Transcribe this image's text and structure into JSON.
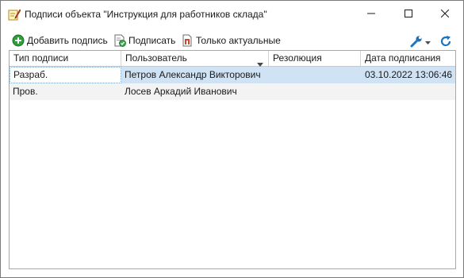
{
  "window": {
    "title": "Подписи объекта \"Инструкция для работников склада\"",
    "icon": "signature-pen-icon",
    "controls": {
      "minimize": "minimize-icon",
      "maximize": "maximize-icon",
      "close": "close-icon"
    }
  },
  "toolbar": {
    "add_label": "Добавить подпись",
    "sign_label": "Подписать",
    "actual_label": "Только актуальные",
    "settings_icon": "wrench-icon",
    "refresh_icon": "refresh-icon"
  },
  "grid": {
    "columns": [
      "Тип подписи",
      "Пользователь",
      "Резолюция",
      "Дата подписания"
    ],
    "sorted_column": "Пользователь",
    "rows": [
      {
        "type": "Разраб.",
        "user": "Петров Александр Викторович",
        "resolution": "",
        "date": "03.10.2022 13:06:46",
        "selected": true
      },
      {
        "type": "Пров.",
        "user": "Лосев Аркадий Иванович",
        "resolution": "",
        "date": "",
        "selected": false
      }
    ]
  },
  "colors": {
    "selection": "#cfe3f5",
    "add_green": "#2e9e3a",
    "accent_blue": "#1e73be"
  }
}
